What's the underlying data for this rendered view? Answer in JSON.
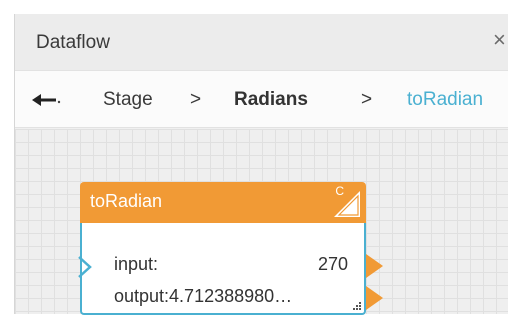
{
  "window": {
    "title": "Dataflow",
    "close_glyph": "×"
  },
  "breadcrumb": {
    "back_icon": "arrow-left-icon",
    "items": [
      {
        "label": "Stage"
      },
      {
        "label": "Radians"
      },
      {
        "label": "toRadian"
      }
    ],
    "separator": ">"
  },
  "node": {
    "title": "toRadian",
    "type_badge": "C",
    "accent_color": "#f19a35",
    "border_color": "#4ab0d1",
    "ports": {
      "input": {
        "label": "input:",
        "value": "270"
      },
      "output": {
        "label": "output:4.712388980…"
      }
    }
  }
}
